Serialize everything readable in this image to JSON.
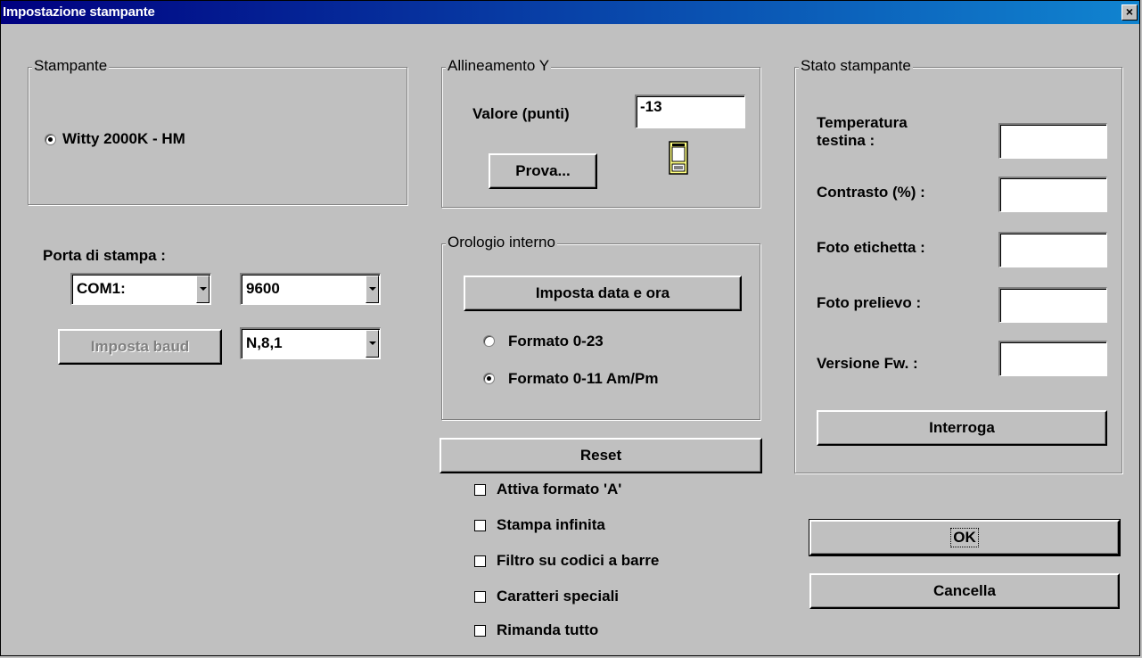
{
  "window": {
    "title": "Impostazione stampante",
    "close_glyph": "×"
  },
  "stampante": {
    "label": "Stampante",
    "printer_option": "Witty 2000K - HM"
  },
  "porta": {
    "label": "Porta di stampa :",
    "port_value": "COM1:",
    "baud_value": "9600",
    "imposta_baud_label": "Imposta baud",
    "params_value": "N,8,1"
  },
  "allineamento": {
    "label": "Allineamento Y",
    "valore_label": "Valore (punti)",
    "valore_value": "-13",
    "prova_label": "Prova...",
    "icon": "printer-label-icon"
  },
  "orologio": {
    "label": "Orologio interno",
    "imposta_label": "Imposta data e ora",
    "format_24": "Formato 0-23",
    "format_12": "Formato 0-11 Am/Pm"
  },
  "reset_label": "Reset",
  "options": [
    "Attiva formato 'A'",
    "Stampa infinita",
    "Filtro su codici a barre",
    "Caratteri speciali",
    "Rimanda tutto"
  ],
  "stato": {
    "label": "Stato stampante",
    "temperatura": "Temperatura testina :",
    "temperatura_line1": "Temperatura",
    "temperatura_line2": "testina :",
    "contrasto": "Contrasto (%) :",
    "foto_etichetta": "Foto etichetta :",
    "foto_prelievo": "Foto prelievo :",
    "versione": "Versione Fw. :",
    "interroga_label": "Interroga"
  },
  "ok_label": "OK",
  "cancella_label": "Cancella",
  "colors": {
    "title_start": "#000080",
    "title_end": "#1084d0",
    "face": "#c0c0c0"
  }
}
